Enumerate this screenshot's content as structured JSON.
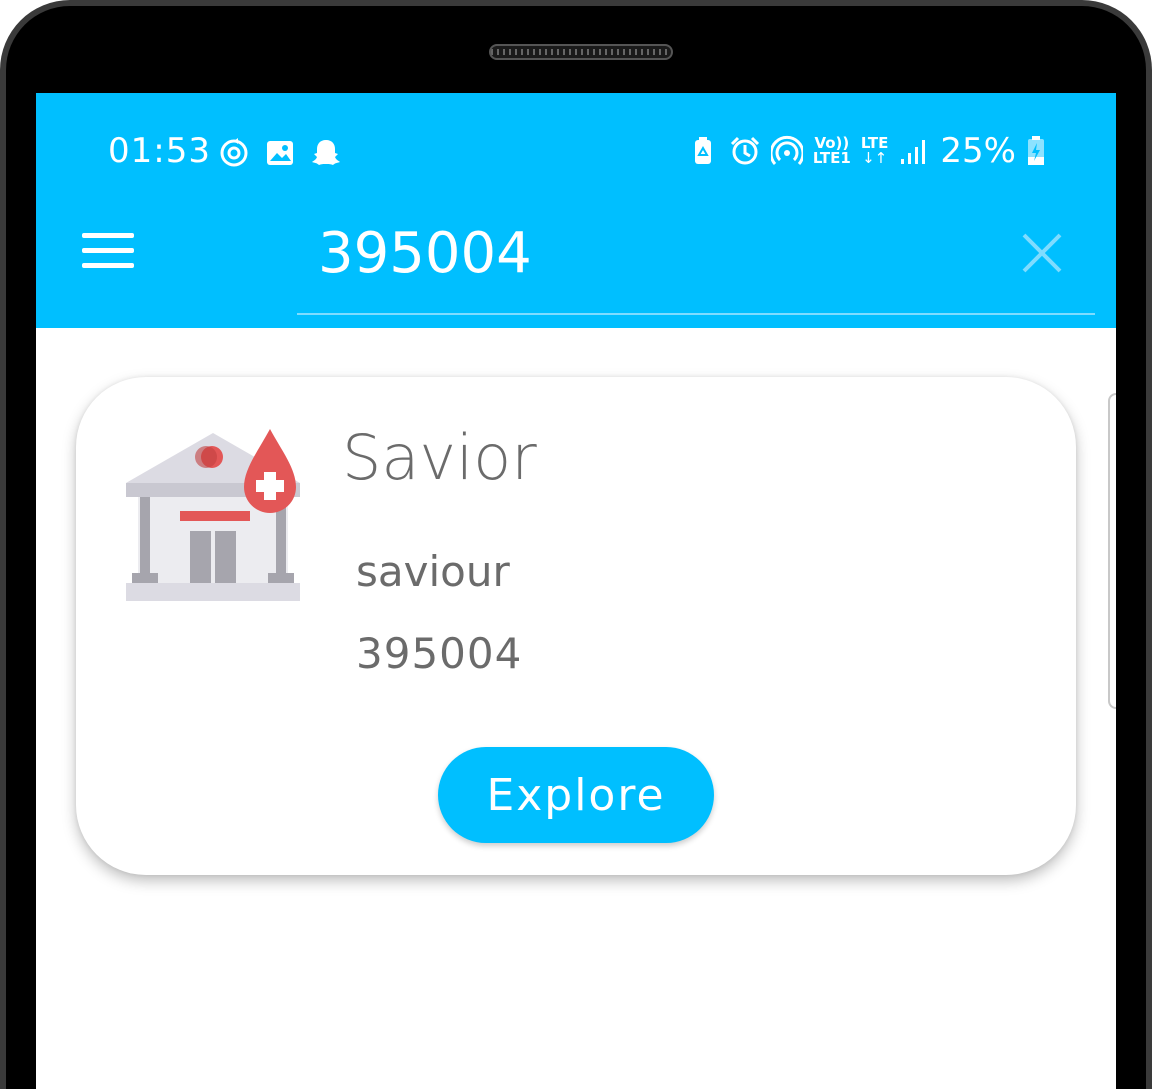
{
  "status_bar": {
    "time": "01:53",
    "left_icons": [
      "sync-icon",
      "gallery-icon",
      "snapchat-icon"
    ],
    "right_icons": [
      "battery-saver-icon",
      "alarm-icon",
      "hotspot-icon",
      "volte-icon",
      "lte-icon",
      "signal-icon"
    ],
    "volte_label_top": "Vo))",
    "volte_label_bottom": "LTE1",
    "lte_label": "LTE",
    "battery_percent": "25%"
  },
  "app_bar": {
    "search_value": "395004",
    "menu_icon": "hamburger-menu-icon",
    "clear_icon": "close-icon"
  },
  "results": [
    {
      "title": "Savior",
      "subtitle": "saviour",
      "code": "395004",
      "icon": "blood-bank-icon",
      "button_label": "Explore"
    }
  ],
  "colors": {
    "accent": "#00bfff",
    "text_gray": "#6b6b6b",
    "blood_red": "#e35757"
  }
}
